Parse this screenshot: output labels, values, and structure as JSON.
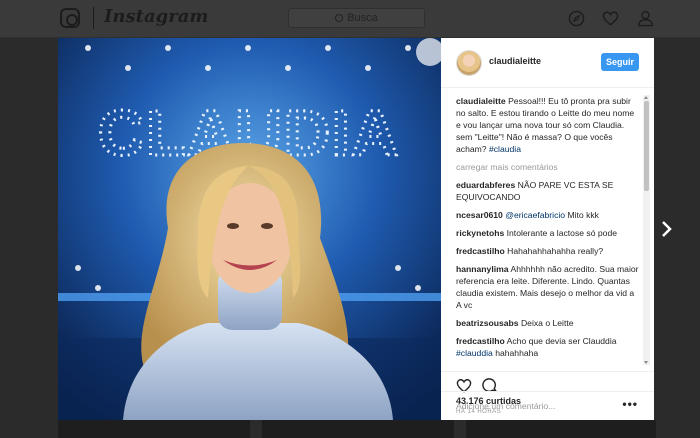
{
  "topbar": {
    "wordmark": "Instagram",
    "search_placeholder": "Busca",
    "icons": [
      "instagram-logo-icon",
      "compass-icon",
      "heart-icon",
      "person-icon"
    ]
  },
  "post": {
    "image_text": "CLAUDIA",
    "username": "claudialeitte",
    "follow_label": "Seguir",
    "caption_user": "claudialeitte",
    "caption_text": "Pessoal!!! Eu tô pronta pra subir no salto. E estou tirando o Leitte do meu nome e vou lançar uma nova tour só com Claudia. sem \"Leitte\"! Não é massa? O que vocês acham?",
    "caption_tag": "#claudia",
    "load_more": "carregar mais comentários",
    "comments": [
      {
        "user": "eduardabferes",
        "text": "NÃO PARE VC ESTA SE EQUIVOCANDO"
      },
      {
        "user": "ncesar0610",
        "mention": "@ericaefabricio",
        "text": "Mito kkk"
      },
      {
        "user": "rickynetohs",
        "text": "Intolerante a lactose só pode"
      },
      {
        "user": "fredcastilho",
        "text": "Hahahahhahahha really?"
      },
      {
        "user": "hannanylima",
        "text": "Ahhhhhh não acredito. Sua maior referencia era leite. Diferente. Lindo. Quantas claudia existem. Mais desejo o melhor da vid a A vc"
      },
      {
        "user": "beatrizsousabs",
        "text": "Deixa o Leitte"
      },
      {
        "user": "fredcastilho",
        "text": "Acho que devia ser Clauddia",
        "tag": "#clauddia",
        "tail": "hahahhaha"
      }
    ],
    "likes": "43.176 curtidas",
    "time": "HÁ 14 HORAS",
    "add_comment_placeholder": "Adicione um comentário...",
    "more_label": "•••"
  },
  "colors": {
    "accent": "#3897f0",
    "link": "#003569",
    "overlay": "#2b2b2b"
  }
}
